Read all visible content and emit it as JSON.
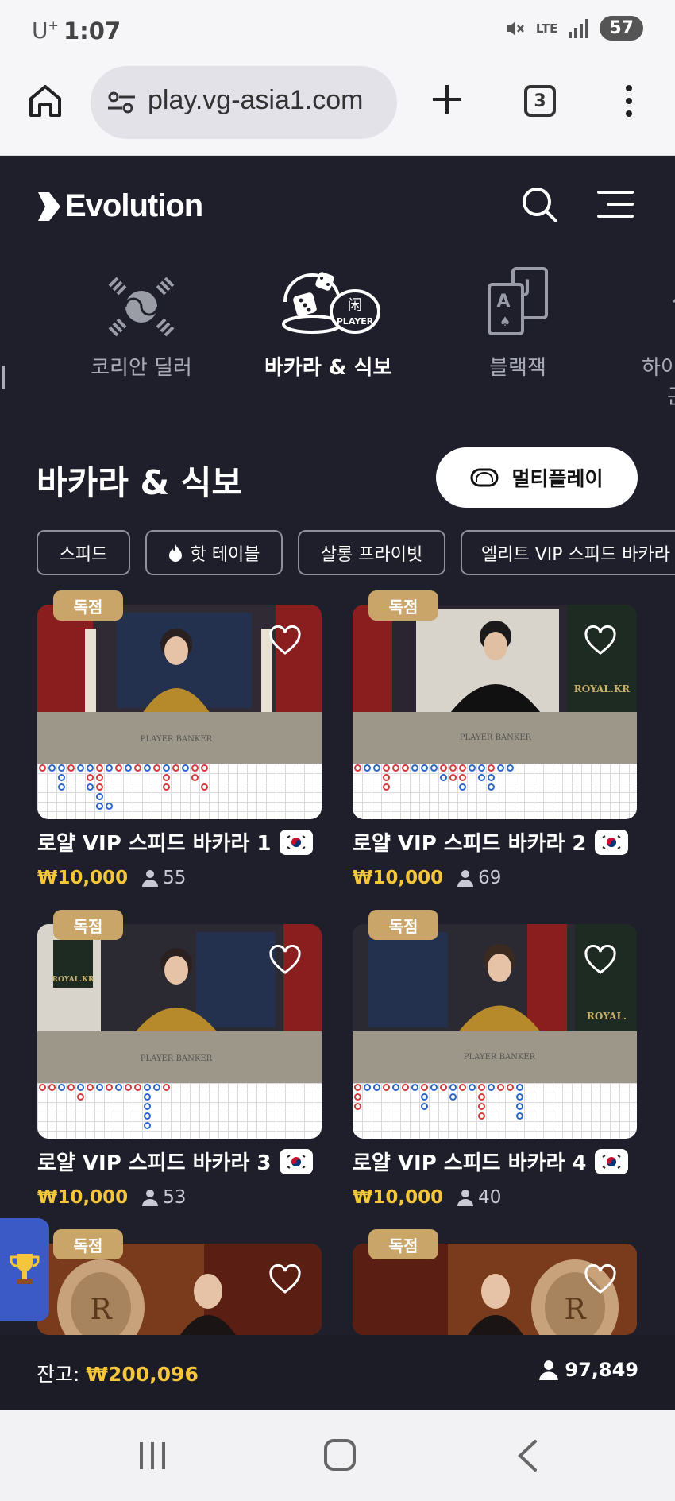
{
  "status_bar": {
    "carrier": "U",
    "carrier_sup": "+",
    "time": "1:07",
    "network": "LTE",
    "battery": "57"
  },
  "browser": {
    "url": "play.vg-asia1.com",
    "tab_count": "3"
  },
  "header": {
    "brand": "Evolution"
  },
  "categories": [
    {
      "label": "",
      "partial": true
    },
    {
      "label": "코리안 딜러",
      "icon": "taegeuk-icon"
    },
    {
      "label": "바카라 & 식보",
      "icon": "dice-baccarat-icon",
      "active": true
    },
    {
      "label": "블랙잭",
      "icon": "playing-cards-icon"
    },
    {
      "label": "하이",
      "sublabel": "곤",
      "icon": "game-icon",
      "partial": true
    }
  ],
  "section": {
    "title": "바카라 & 식보",
    "multiplay_label": "멀티플레이"
  },
  "chips": [
    "스피드",
    "핫 테이블",
    "살롱 프라이빗",
    "엘리트 VIP 스피드 바카라"
  ],
  "tables": [
    {
      "badge": "독점",
      "name": "로얄 VIP 스피드 바카라 1",
      "price": "₩10,000",
      "players": "55"
    },
    {
      "badge": "독점",
      "name": "로얄 VIP 스피드 바카라 2",
      "price": "₩10,000",
      "players": "69"
    },
    {
      "badge": "독점",
      "name": "로얄 VIP 스피드 바카라 3",
      "price": "₩10,000",
      "players": "53"
    },
    {
      "badge": "독점",
      "name": "로얄 VIP 스피드 바카라 4",
      "price": "₩10,000",
      "players": "40"
    },
    {
      "badge": "독점"
    },
    {
      "badge": "독점"
    }
  ],
  "footer": {
    "balance_label": "잔고:",
    "balance": "₩200,096",
    "online": "97,849"
  },
  "colors": {
    "bg": "#1e1f2b",
    "gold": "#f3c63b",
    "badge": "#c9a56a",
    "accent_blue": "#3c5ac6"
  }
}
